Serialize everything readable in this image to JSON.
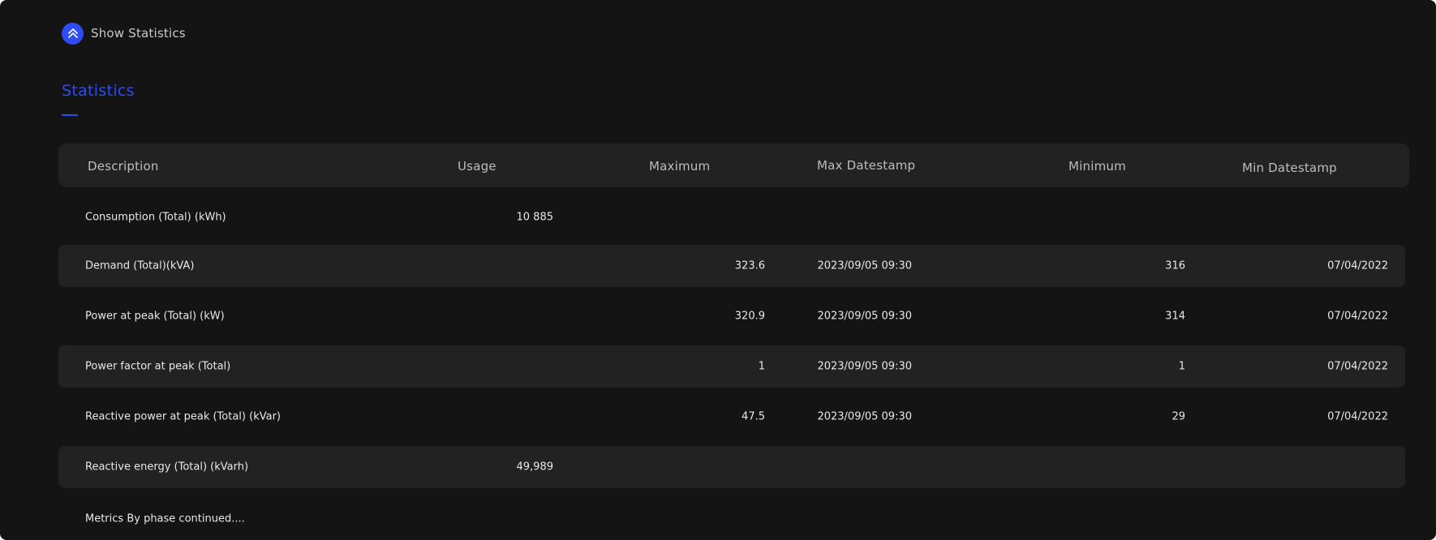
{
  "toggle": {
    "label": "Show Statistics",
    "icon": "chevrons-up-icon",
    "accent": "#2f4cf2"
  },
  "section": {
    "title": "Statistics"
  },
  "table": {
    "columns": [
      "Description",
      "Usage",
      "Maximum",
      "Max Datestamp",
      "Minimum",
      "Min Datestamp"
    ],
    "rows": [
      {
        "description": "Consumption (Total) (kWh)",
        "usage": "10 885",
        "maximum": "",
        "max_datestamp": "",
        "minimum": "",
        "min_datestamp": ""
      },
      {
        "description": "Demand (Total)(kVA)",
        "usage": "",
        "maximum": "323.6",
        "max_datestamp": "2023/09/05 09:30",
        "minimum": "316",
        "min_datestamp": "07/04/2022"
      },
      {
        "description": "Power at peak (Total) (kW)",
        "usage": "",
        "maximum": "320.9",
        "max_datestamp": "2023/09/05 09:30",
        "minimum": "314",
        "min_datestamp": "07/04/2022"
      },
      {
        "description": "Power factor at peak (Total)",
        "usage": "",
        "maximum": "1",
        "max_datestamp": "2023/09/05 09:30",
        "minimum": "1",
        "min_datestamp": "07/04/2022"
      },
      {
        "description": "Reactive power at peak (Total) (kVar)",
        "usage": "",
        "maximum": "47.5",
        "max_datestamp": "2023/09/05 09:30",
        "minimum": "29",
        "min_datestamp": "07/04/2022"
      },
      {
        "description": "Reactive energy (Total) (kVarh)",
        "usage": "49,989",
        "maximum": "",
        "max_datestamp": "",
        "minimum": "",
        "min_datestamp": ""
      },
      {
        "description": "Metrics By phase continued....",
        "usage": "",
        "maximum": "",
        "max_datestamp": "",
        "minimum": "",
        "min_datestamp": ""
      }
    ]
  }
}
